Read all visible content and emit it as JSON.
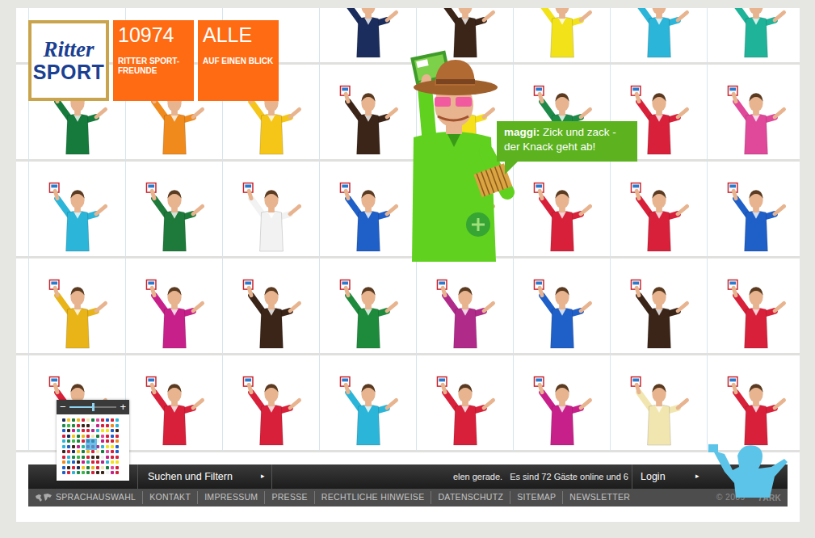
{
  "header": {
    "logo": {
      "line1": "Ritter",
      "line2": "SPORT"
    },
    "count_tile": {
      "number": "10974",
      "label": "RITTER SPORT-FREUNDE"
    },
    "filter_tile": {
      "title": "ALLE",
      "label": "AUF EINEN BLICK"
    }
  },
  "grid": {
    "rows": [
      [
        null,
        null,
        null,
        {
          "color": "#1b2d5c"
        },
        {
          "color": "#3b2418"
        },
        {
          "color": "#f2e21a"
        },
        {
          "color": "#2bb5d8"
        },
        {
          "color": "#1fb39a"
        }
      ],
      [
        {
          "color": "#157a3c"
        },
        {
          "color": "#f08a1c"
        },
        {
          "color": "#f5c518"
        },
        {
          "color": "#3b2418"
        },
        {
          "color": "#f5e01a"
        },
        {
          "color": "#1e8a4a"
        },
        {
          "color": "#d8203a"
        },
        {
          "color": "#e0489a"
        }
      ],
      [
        {
          "color": "#2bb5d8"
        },
        {
          "color": "#1e7a3a"
        },
        {
          "color": "#f2f2f2"
        },
        {
          "color": "#1f5fc8"
        },
        {
          "color": "#39b54a"
        },
        {
          "color": "#d8203a"
        },
        {
          "color": "#d8203a"
        },
        {
          "color": "#1f5fc8"
        }
      ],
      [
        {
          "color": "#e8b418"
        },
        {
          "color": "#c8208a"
        },
        {
          "color": "#3b2418"
        },
        {
          "color": "#1e8a3c"
        },
        {
          "color": "#b02a8a"
        },
        {
          "color": "#1f5fc8"
        },
        {
          "color": "#3b2418"
        },
        {
          "color": "#d8203a"
        }
      ],
      [
        {
          "color": "#d8203a"
        },
        {
          "color": "#d8203a"
        },
        {
          "color": "#d8203a"
        },
        {
          "color": "#2bb5d8"
        },
        {
          "color": "#d8203a"
        },
        {
          "color": "#c8208a"
        },
        {
          "color": "#f2e6b0"
        },
        {
          "color": "#d8203a"
        }
      ]
    ]
  },
  "featured": {
    "user": "maggi:",
    "message": "Zick und zack - der Knack geht ab!",
    "color": "#5fd11e"
  },
  "zoom": {
    "minus": "−",
    "plus": "+",
    "level": 0.5
  },
  "bottom_bar": {
    "search": "Suchen und Filtern",
    "search_arrow": "▸",
    "ticker": "elen gerade.   Es sind 72 Gäste online und 6",
    "login": "Login",
    "login_arrow": "▸"
  },
  "footer": {
    "links": [
      "SPRACHAUSWAHL",
      "KONTAKT",
      "IMPRESSUM",
      "PRESSE",
      "RECHTLICHE HINWEISE",
      "DATENSCHUTZ",
      "SITEMAP",
      "NEWSLETTER"
    ],
    "copyright": "© 2009",
    "credit": "7ARK"
  }
}
